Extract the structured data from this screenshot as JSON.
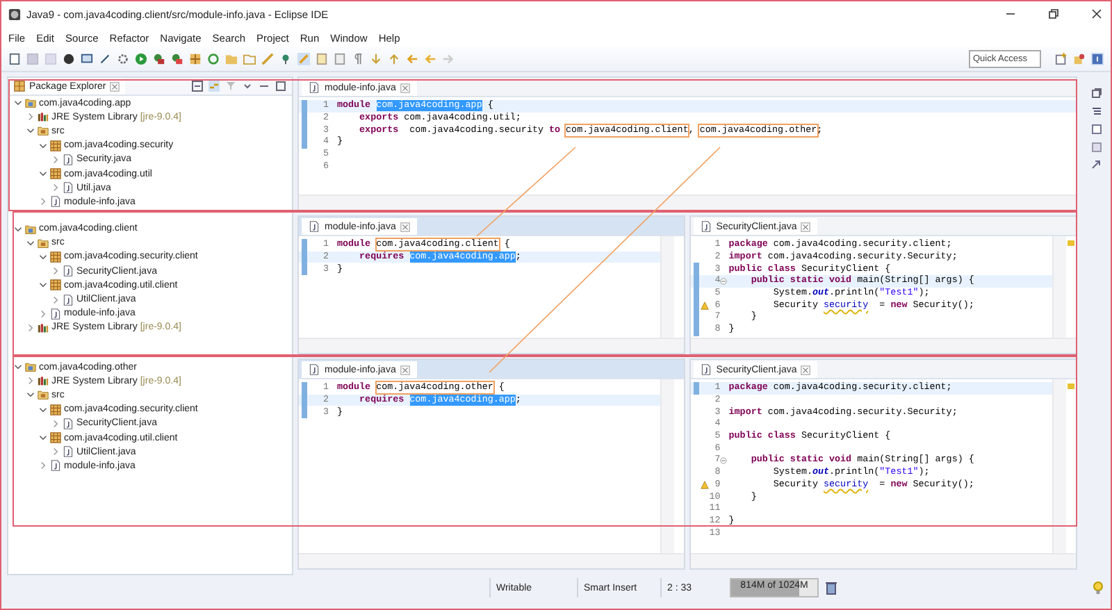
{
  "window": {
    "title": "Java9 - com.java4coding.client/src/module-info.java - Eclipse IDE"
  },
  "menu": [
    "File",
    "Edit",
    "Source",
    "Refactor",
    "Navigate",
    "Search",
    "Project",
    "Run",
    "Window",
    "Help"
  ],
  "quick_access": {
    "placeholder": "Quick Access"
  },
  "explorer": {
    "title": "Package Explorer",
    "projects": [
      {
        "label": "com.java4coding.app",
        "kind": "project",
        "expanded": true,
        "children": [
          {
            "label": "JRE System Library",
            "decoration": "[jre-9.0.4]",
            "kind": "library",
            "expanded": false
          },
          {
            "label": "src",
            "kind": "source_folder",
            "expanded": true,
            "children": [
              {
                "label": "com.java4coding.security",
                "kind": "package",
                "expanded": true,
                "children": [
                  {
                    "label": "Security.java",
                    "kind": "file",
                    "expanded": false
                  }
                ]
              },
              {
                "label": "com.java4coding.util",
                "kind": "package",
                "expanded": true,
                "children": [
                  {
                    "label": "Util.java",
                    "kind": "file",
                    "expanded": false
                  }
                ]
              },
              {
                "label": "module-info.java",
                "kind": "file",
                "expanded": false
              }
            ]
          }
        ]
      },
      {
        "label": "com.java4coding.client",
        "kind": "project",
        "expanded": true,
        "children": [
          {
            "label": "src",
            "kind": "source_folder",
            "expanded": true,
            "children": [
              {
                "label": "com.java4coding.security.client",
                "kind": "package",
                "expanded": true,
                "children": [
                  {
                    "label": "SecurityClient.java",
                    "kind": "file",
                    "expanded": false
                  }
                ]
              },
              {
                "label": "com.java4coding.util.client",
                "kind": "package",
                "expanded": true,
                "children": [
                  {
                    "label": "UtilClient.java",
                    "kind": "file",
                    "expanded": false
                  }
                ]
              },
              {
                "label": "module-info.java",
                "kind": "file",
                "expanded": false
              }
            ]
          },
          {
            "label": "JRE System Library",
            "decoration": "[jre-9.0.4]",
            "kind": "library",
            "expanded": false
          }
        ]
      },
      {
        "label": "com.java4coding.other",
        "kind": "project",
        "expanded": true,
        "children": [
          {
            "label": "JRE System Library",
            "decoration": "[jre-9.0.4]",
            "kind": "library",
            "expanded": false
          },
          {
            "label": "src",
            "kind": "source_folder",
            "expanded": true,
            "children": [
              {
                "label": "com.java4coding.security.client",
                "kind": "package",
                "expanded": true,
                "children": [
                  {
                    "label": "SecurityClient.java",
                    "kind": "file",
                    "expanded": false
                  }
                ]
              },
              {
                "label": "com.java4coding.util.client",
                "kind": "package",
                "expanded": true,
                "children": [
                  {
                    "label": "UtilClient.java",
                    "kind": "file",
                    "expanded": false
                  }
                ]
              },
              {
                "label": "module-info.java",
                "kind": "file",
                "expanded": false
              }
            ]
          }
        ]
      }
    ]
  },
  "editor_rows": [
    [
      {
        "tab": "module-info.java",
        "active": false,
        "lines": [
          {
            "n": "1",
            "range": true,
            "current": true,
            "tokens": [
              {
                "kind": "keyword",
                "text": "module "
              },
              {
                "kind": "selected",
                "text": "com.java4coding.app"
              },
              {
                "kind": "plain",
                "text": " {"
              }
            ]
          },
          {
            "n": "2",
            "range": true,
            "current": false,
            "tokens": [
              {
                "kind": "keyword",
                "text": "    exports"
              },
              {
                "kind": "plain",
                "text": " com.java4coding.util;"
              }
            ]
          },
          {
            "n": "3",
            "range": true,
            "current": false,
            "tokens": [
              {
                "kind": "keyword",
                "text": "    exports"
              },
              {
                "kind": "plain",
                "text": "  com.java4coding.security "
              },
              {
                "kind": "keyword",
                "text": "to "
              },
              {
                "kind": "boxed",
                "text": "com.java4coding.client"
              },
              {
                "kind": "plain",
                "text": ", "
              },
              {
                "kind": "boxed",
                "text": "com.java4coding.other"
              },
              {
                "kind": "plain",
                "text": ";"
              }
            ]
          },
          {
            "n": "4",
            "range": true,
            "current": false,
            "tokens": [
              {
                "kind": "plain",
                "text": "}"
              }
            ]
          },
          {
            "n": "5",
            "range": false,
            "current": false
          },
          {
            "n": "6",
            "range": false,
            "current": false
          }
        ]
      }
    ],
    [
      {
        "tab": "module-info.java",
        "active": true,
        "lines": [
          {
            "n": "1",
            "range": true,
            "current": false,
            "tokens": [
              {
                "kind": "keyword",
                "text": "module "
              },
              {
                "kind": "boxed",
                "text": "com.java4coding.client"
              },
              {
                "kind": "plain",
                "text": " {"
              }
            ]
          },
          {
            "n": "2",
            "range": true,
            "current": true,
            "tokens": [
              {
                "kind": "keyword",
                "text": "    requires "
              },
              {
                "kind": "selected",
                "text": "com.java4coding.app"
              },
              {
                "kind": "plain",
                "text": ";"
              }
            ]
          },
          {
            "n": "3",
            "range": true,
            "current": false,
            "tokens": [
              {
                "kind": "plain",
                "text": "}"
              }
            ]
          }
        ]
      },
      {
        "tab": "SecurityClient.java",
        "active": false,
        "lines": [
          {
            "n": "1",
            "range": false,
            "current": false,
            "tokens": [
              {
                "kind": "keyword",
                "text": "package"
              },
              {
                "kind": "plain",
                "text": " com.java4coding.security.client;"
              }
            ]
          },
          {
            "n": "2",
            "range": false,
            "current": false,
            "tokens": [
              {
                "kind": "keyword",
                "text": "import"
              },
              {
                "kind": "plain",
                "text": " com.java4coding.security.Security;"
              }
            ]
          },
          {
            "n": "3",
            "range": true,
            "current": false,
            "tokens": [
              {
                "kind": "keyword",
                "text": "public class"
              },
              {
                "kind": "plain",
                "text": " SecurityClient {"
              }
            ]
          },
          {
            "n": "4",
            "range": true,
            "current": true,
            "fold": true,
            "tokens": [
              {
                "kind": "keyword",
                "text": "    public static void"
              },
              {
                "kind": "plain",
                "text": " main(String[] args) {"
              }
            ]
          },
          {
            "n": "5",
            "range": true,
            "current": false,
            "tokens": [
              {
                "kind": "plain",
                "text": "        System."
              },
              {
                "kind": "field",
                "text": "out"
              },
              {
                "kind": "plain",
                "text": ".println("
              },
              {
                "kind": "string",
                "text": "\"Test1\""
              },
              {
                "kind": "plain",
                "text": ");"
              }
            ]
          },
          {
            "n": "6",
            "range": true,
            "current": false,
            "warning": true,
            "tokens": [
              {
                "kind": "plain",
                "text": "        Security "
              },
              {
                "kind": "warning",
                "text": "security"
              },
              {
                "kind": "plain",
                "text": "  = "
              },
              {
                "kind": "keyword",
                "text": "new"
              },
              {
                "kind": "plain",
                "text": " Security();"
              }
            ]
          },
          {
            "n": "7",
            "range": true,
            "current": false,
            "tokens": [
              {
                "kind": "plain",
                "text": "    }"
              }
            ]
          },
          {
            "n": "8",
            "range": true,
            "current": false,
            "tokens": [
              {
                "kind": "plain",
                "text": "}"
              }
            ]
          }
        ]
      }
    ],
    [
      {
        "tab": "module-info.java",
        "active": true,
        "lines": [
          {
            "n": "1",
            "range": true,
            "current": false,
            "tokens": [
              {
                "kind": "keyword",
                "text": "module "
              },
              {
                "kind": "boxed",
                "text": "com.java4coding.other"
              },
              {
                "kind": "plain",
                "text": " {"
              }
            ]
          },
          {
            "n": "2",
            "range": true,
            "current": true,
            "tokens": [
              {
                "kind": "keyword",
                "text": "    requires "
              },
              {
                "kind": "selected",
                "text": "com.java4coding.app"
              },
              {
                "kind": "plain",
                "text": ";"
              }
            ]
          },
          {
            "n": "3",
            "range": true,
            "current": false,
            "tokens": [
              {
                "kind": "plain",
                "text": "}"
              }
            ]
          }
        ]
      },
      {
        "tab": "SecurityClient.java",
        "active": false,
        "lines": [
          {
            "n": "1",
            "range": true,
            "current": true,
            "tokens": [
              {
                "kind": "keyword",
                "text": "package"
              },
              {
                "kind": "plain",
                "text": " com.java4coding.security.client;"
              }
            ]
          },
          {
            "n": "2",
            "range": false,
            "current": false
          },
          {
            "n": "3",
            "range": false,
            "current": false,
            "tokens": [
              {
                "kind": "keyword",
                "text": "import"
              },
              {
                "kind": "plain",
                "text": " com.java4coding.security.Security;"
              }
            ]
          },
          {
            "n": "4",
            "range": false,
            "current": false
          },
          {
            "n": "5",
            "range": false,
            "current": false,
            "tokens": [
              {
                "kind": "keyword",
                "text": "public class"
              },
              {
                "kind": "plain",
                "text": " SecurityClient {"
              }
            ]
          },
          {
            "n": "6",
            "range": false,
            "current": false
          },
          {
            "n": "7",
            "range": false,
            "current": false,
            "fold": true,
            "tokens": [
              {
                "kind": "keyword",
                "text": "    public static void"
              },
              {
                "kind": "plain",
                "text": " main(String[] args) {"
              }
            ]
          },
          {
            "n": "8",
            "range": false,
            "current": false,
            "tokens": [
              {
                "kind": "plain",
                "text": "        System."
              },
              {
                "kind": "field",
                "text": "out"
              },
              {
                "kind": "plain",
                "text": ".println("
              },
              {
                "kind": "string",
                "text": "\"Test1\""
              },
              {
                "kind": "plain",
                "text": ");"
              }
            ]
          },
          {
            "n": "9",
            "range": false,
            "current": false,
            "warning": true,
            "tokens": [
              {
                "kind": "plain",
                "text": "        Security "
              },
              {
                "kind": "warning",
                "text": "security"
              },
              {
                "kind": "plain",
                "text": "  = "
              },
              {
                "kind": "keyword",
                "text": "new"
              },
              {
                "kind": "plain",
                "text": " Security();"
              }
            ]
          },
          {
            "n": "10",
            "range": false,
            "current": false,
            "tokens": [
              {
                "kind": "plain",
                "text": "    }"
              }
            ]
          },
          {
            "n": "11",
            "range": false,
            "current": false
          },
          {
            "n": "12",
            "range": false,
            "current": false,
            "tokens": [
              {
                "kind": "plain",
                "text": "}"
              }
            ]
          },
          {
            "n": "13",
            "range": false,
            "current": false
          }
        ]
      }
    ]
  ],
  "status_bar": {
    "mode": "Writable",
    "insert_mode": "Smart Insert",
    "position": "2 : 33",
    "heap": {
      "text": "814M of 1024M",
      "level": 0.795
    }
  }
}
